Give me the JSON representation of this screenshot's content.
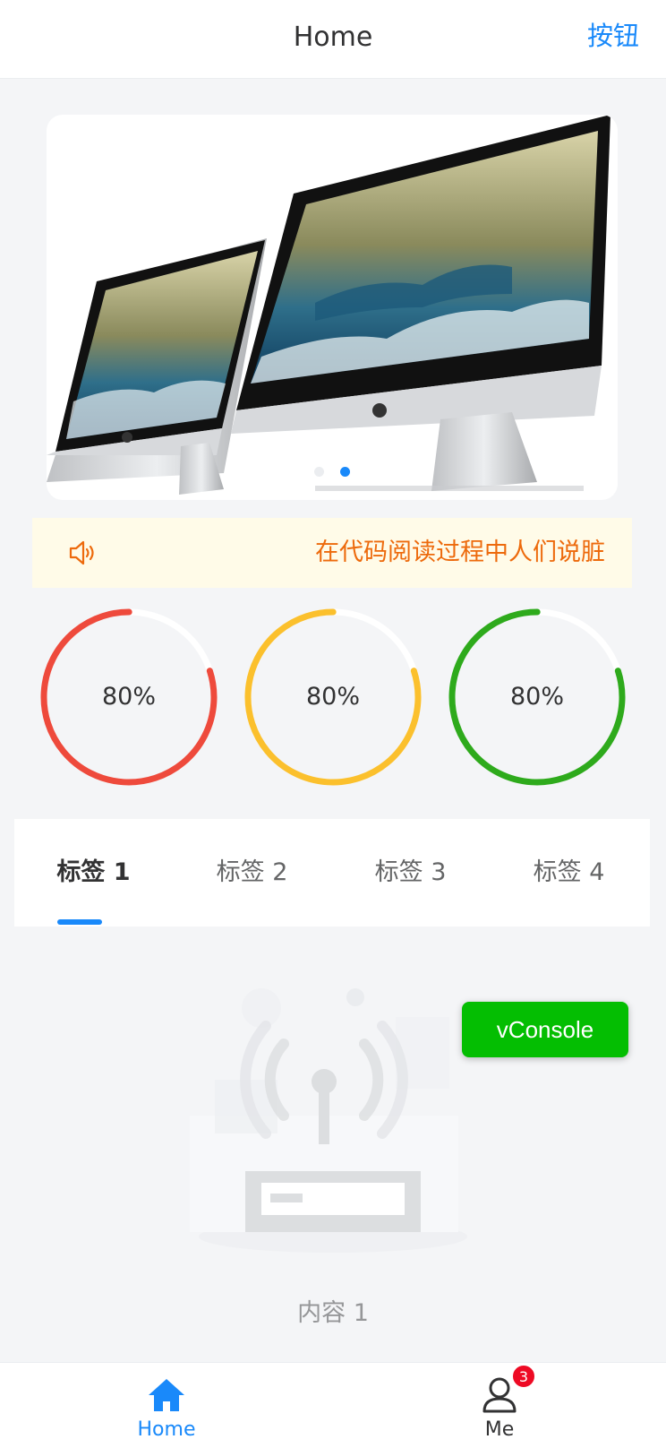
{
  "nav": {
    "title": "Home",
    "right_label": "按钮"
  },
  "swipe": {
    "total_slides": 2,
    "active_index": 1
  },
  "notice": {
    "text": "在代码阅读过程中人们说脏",
    "icon": "volume-icon"
  },
  "circles": [
    {
      "text": "80%",
      "rate": 80,
      "color": "#ee4a3c"
    },
    {
      "text": "80%",
      "rate": 80,
      "color": "#fbc02d"
    },
    {
      "text": "80%",
      "rate": 80,
      "color": "#2eaa1c"
    }
  ],
  "tabs": {
    "items": [
      "标签 1",
      "标签 2",
      "标签 3",
      "标签 4"
    ],
    "active_index": 0
  },
  "content": {
    "text": "内容 1"
  },
  "vconsole": {
    "label": "vConsole"
  },
  "tabbar": {
    "items": [
      {
        "label": "Home",
        "icon": "home-icon"
      },
      {
        "label": "Me",
        "icon": "user-icon",
        "badge": "3"
      }
    ],
    "active_index": 0
  },
  "colors": {
    "accent": "#1989fa",
    "notice_bg": "#fffbe8",
    "notice_text": "#ed6a0c",
    "vconsole": "#04be02",
    "badge": "#ee0a24"
  }
}
